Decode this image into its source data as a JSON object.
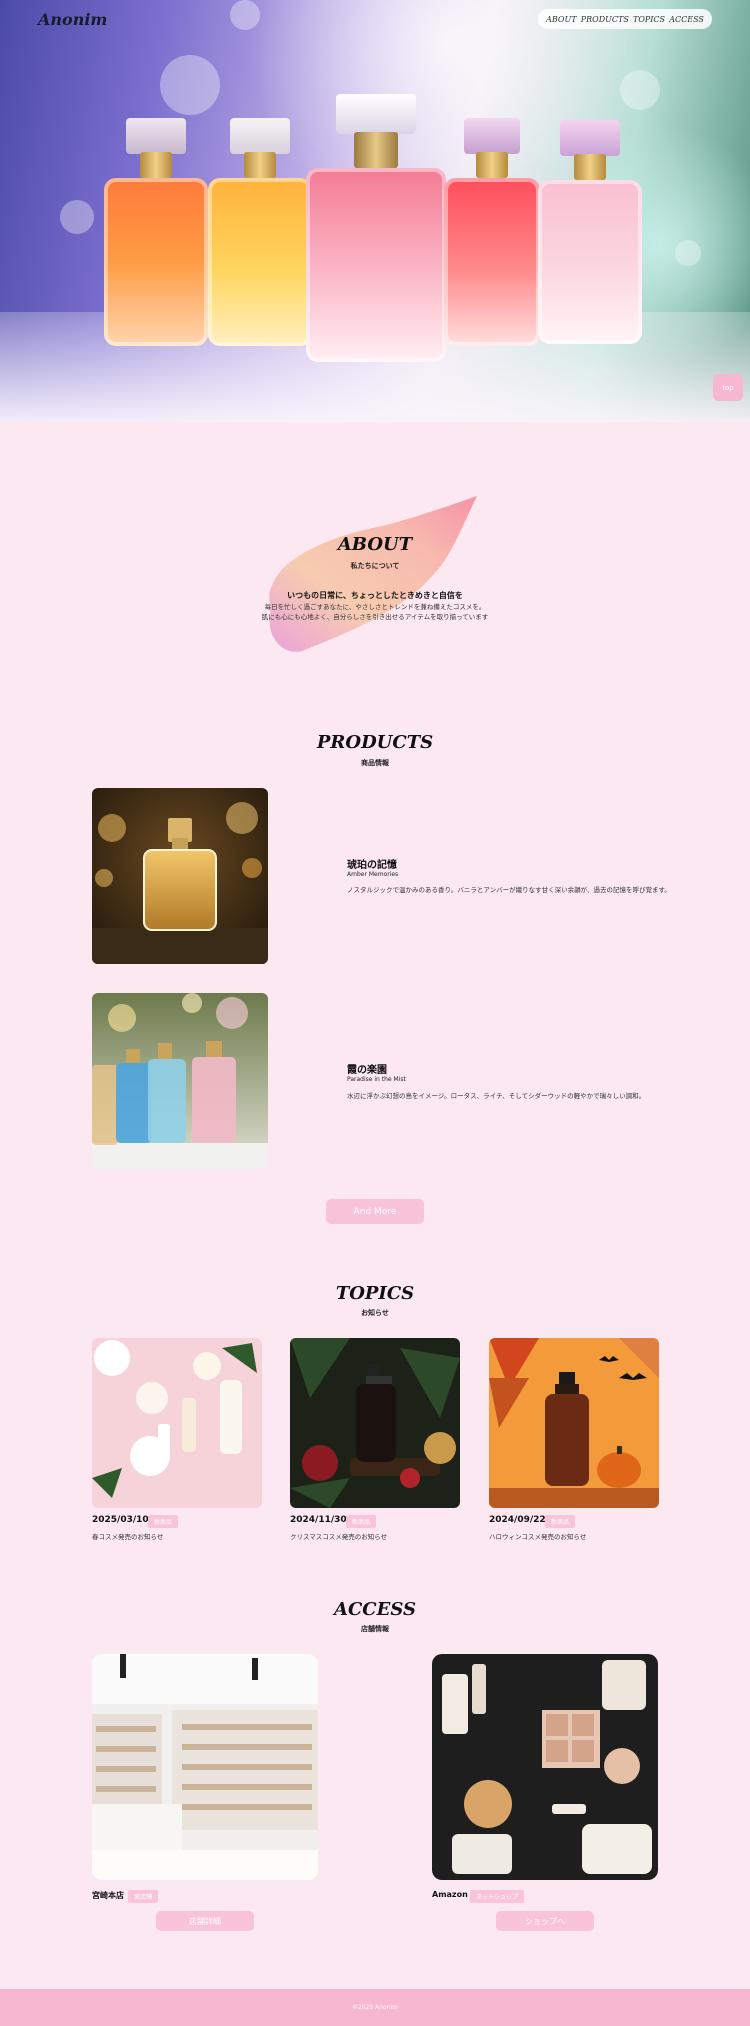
{
  "header": {
    "logo": "Anonim",
    "nav": [
      "ABOUT",
      "PRODUCTS",
      "TOPICS",
      "ACCESS"
    ],
    "page_top": "top"
  },
  "about": {
    "title": "ABOUT",
    "subtitle": "私たちについて",
    "heading": "いつもの日常に、ちょっとしたときめきと自信を",
    "line1": "毎日を忙しく過ごすあなたに、やさしさとトレンドを兼ね備えたコスメを。",
    "line2": "肌にも心にも心地よく、自分らしさを引き出せるアイテムを取り揃っています"
  },
  "products": {
    "title": "PRODUCTS",
    "subtitle": "商品情報",
    "items": [
      {
        "name": "琥珀の記憶",
        "en": "Amber Memories",
        "desc": "ノスタルジックで温かみのある香り。バニラとアンバーが織りなす甘く深い余韻が、過去の記憶を呼び覚ます。"
      },
      {
        "name": "霞の楽園",
        "en": "Paradise in the Mist",
        "desc": "水辺に浮かぶ幻想の島をイメージ。ロータス、ライチ、そしてシダーウッドの軽やかで瑞々しい調和。"
      }
    ],
    "more_button": "And More"
  },
  "topics": {
    "title": "TOPICS",
    "subtitle": "お知らせ",
    "items": [
      {
        "date": "2025/03/10",
        "tag": "新商品",
        "text": "春コスメ発売のお知らせ"
      },
      {
        "date": "2024/11/30",
        "tag": "新商品",
        "text": "クリスマスコスメ発売のお知らせ"
      },
      {
        "date": "2024/09/22",
        "tag": "新商品",
        "text": "ハロウィンコスメ発売のお知らせ"
      }
    ]
  },
  "access": {
    "title": "ACCESS",
    "subtitle": "店舗情報",
    "stores": [
      {
        "name": "宮崎本店",
        "tag": "実店舗",
        "button": "店舗詳細"
      },
      {
        "name": "Amazon",
        "tag": "ネットショップ",
        "button": "ショップへ"
      }
    ]
  },
  "footer": {
    "copyright": "©2025 Anonim"
  }
}
